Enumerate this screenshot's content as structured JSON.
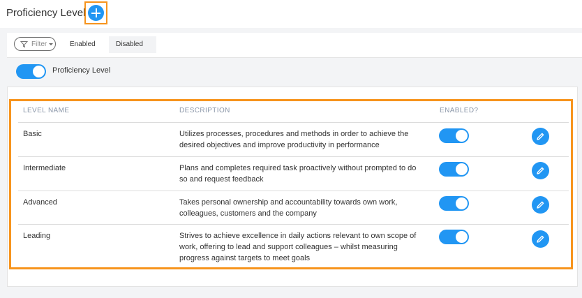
{
  "header": {
    "title": "Proficiency Level",
    "add_icon": "plus-icon"
  },
  "filters": {
    "filter_label": "Filter",
    "filter_icon": "funnel-icon",
    "enabled_label": "Enabled",
    "disabled_label": "Disabled"
  },
  "master": {
    "label": "Proficiency Level",
    "enabled": true
  },
  "table": {
    "headers": {
      "level_name": "LEVEL NAME",
      "description": "DESCRIPTION",
      "enabled": "ENABLED?"
    },
    "rows": [
      {
        "name": "Basic",
        "desc_lines": [
          "Utilizes processes, procedures and methods in order to achieve the",
          "desired objectives and improve productivity in performance"
        ],
        "enabled": true
      },
      {
        "name": "Intermediate",
        "desc_lines": [
          "Plans and completes required task proactively without prompted to do",
          "so and request feedback"
        ],
        "enabled": true
      },
      {
        "name": "Advanced",
        "desc_lines": [
          "Takes personal ownership and accountability towards own work,",
          "colleagues, customers and the company"
        ],
        "enabled": true
      },
      {
        "name": "Leading",
        "desc_lines": [
          "Strives to achieve excellence in daily actions relevant to own scope of",
          "work, offering to lead and support colleagues – whilst measuring",
          "progress against targets to meet goals"
        ],
        "enabled": true
      }
    ]
  },
  "colors": {
    "accent": "#2196f3",
    "highlight": "#f7941d"
  }
}
